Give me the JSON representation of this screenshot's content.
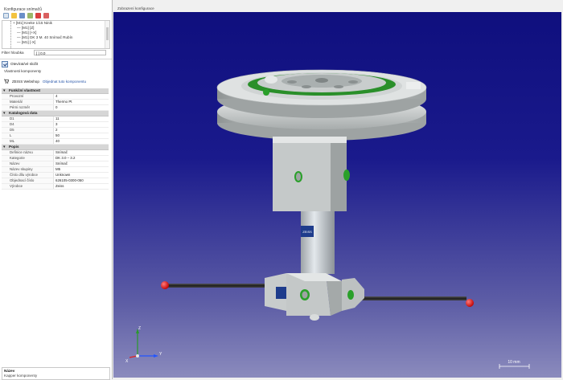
{
  "left_panel": {
    "title": "Konfigurace snímačů",
    "tree_items": [
      "+ [M1] Keeke 1/15 Ninik",
      "— [M1] [Z]",
      "— [M1] [+X]",
      "— [M1] DK 3 M. 40 Snímač Rubín",
      "— [M1] [-X]"
    ],
    "filter": {
      "label": "Filter hloubka",
      "value": "[ ] 0.0"
    },
    "opened_label": "Otevírat/vé složit",
    "component_props_title": "Vlastnosti komponenty",
    "zeiss_label": "ZEISS Webshop",
    "zeiss_link": "Objednat tuto komponentu",
    "sections": [
      {
        "name": "Funkční vlastnost",
        "rows": [
          {
            "k": "Provozní",
            "v": "4"
          },
          {
            "k": "Materiál",
            "v": "Thermo Pt"
          },
          {
            "k": "Pérni rozměr",
            "v": "0"
          }
        ]
      },
      {
        "name": "Katalogová data",
        "rows": [
          {
            "k": "D1",
            "v": "11"
          },
          {
            "k": "D4",
            "v": "3"
          },
          {
            "k": "D5",
            "v": "2"
          },
          {
            "k": "L",
            "v": "50"
          },
          {
            "k": "ML",
            "v": "40"
          }
        ]
      },
      {
        "name": "Popis",
        "rows": [
          {
            "k": "Definice názvu",
            "v": "Snímač"
          },
          {
            "k": "Kategorie",
            "v": "DK 3.0 – 3.2"
          },
          {
            "k": "Název",
            "v": "Snímač"
          },
          {
            "k": "Název skupiny",
            "v": "M5"
          },
          {
            "k": "Číslo dílu výrobce",
            "v": "Unknown"
          },
          {
            "k": "Objednací číslo",
            "v": "626105-0300-050"
          },
          {
            "k": "Výrobce",
            "v": "Zeiss"
          }
        ]
      }
    ],
    "bottom": {
      "title": "Název",
      "subtitle": "Kapper komponenty"
    }
  },
  "viewport": {
    "header": "Zobrazení konfigurace",
    "brand": "ZEISS",
    "scale_label": "10 mm",
    "axes": {
      "z": "Z",
      "y": "Y",
      "x": "X"
    }
  },
  "colors": {
    "bg_top": "#0f0f7e",
    "bg_bottom": "#8b8bbd",
    "part_gray": "#bfc3c3",
    "green": "#2aa02a",
    "ruby": "#e81212",
    "zeiss_blue": "#1e3c8c"
  }
}
